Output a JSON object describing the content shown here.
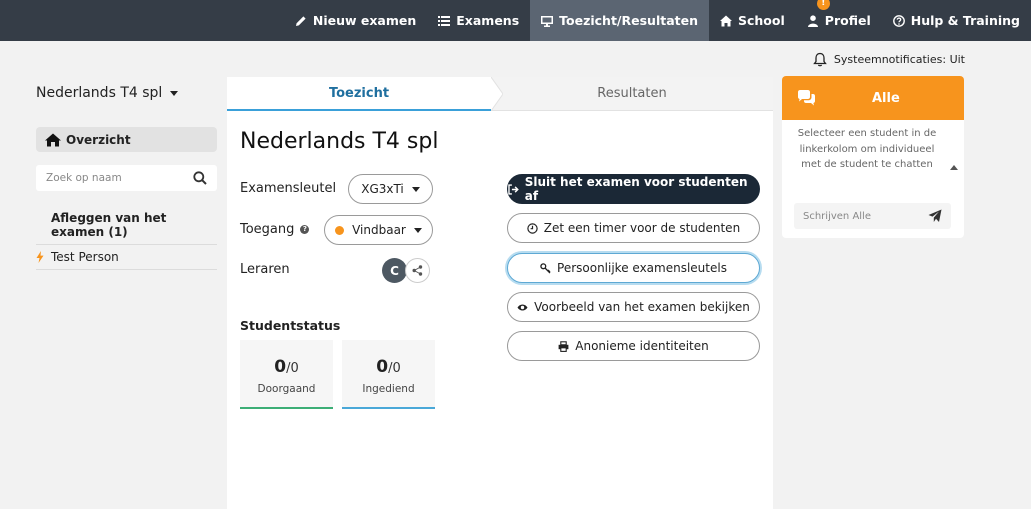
{
  "nav": {
    "items": [
      {
        "label": "Nieuw examen",
        "icon": "pencil-icon",
        "active": false
      },
      {
        "label": "Examens",
        "icon": "list-icon",
        "active": false
      },
      {
        "label": "Toezicht/Resultaten",
        "icon": "monitor-icon",
        "active": true
      },
      {
        "label": "School",
        "icon": "home-icon",
        "active": false
      },
      {
        "label": "Profiel",
        "icon": "user-icon",
        "active": false,
        "badge": "!"
      },
      {
        "label": "Hulp & Training",
        "icon": "question-circle-icon",
        "active": false
      }
    ]
  },
  "notifications": {
    "label": "Systeemnotificaties: Uit",
    "icon": "bell-icon"
  },
  "sidebar": {
    "exam_name": "Nederlands T4 spl",
    "overview_label": "Overzicht",
    "search_placeholder": "Zoek op naam",
    "group_title": "Afleggen van het examen (1)",
    "students": [
      {
        "name": "Test Person",
        "status_icon": "bolt-icon"
      }
    ]
  },
  "tabs": {
    "toezicht": "Toezicht",
    "resultaten": "Resultaten"
  },
  "main": {
    "title": "Nederlands T4 spl",
    "examkey_label": "Examensleutel",
    "examkey_value": "XG3xTi",
    "access_label": "Toegang",
    "access_value": "Vindbaar",
    "teachers_label": "Leraren",
    "teacher_initial": "C",
    "status_title": "Studentstatus",
    "stats": [
      {
        "value": "0",
        "total": "/0",
        "caption": "Doorgaand"
      },
      {
        "value": "0",
        "total": "/0",
        "caption": "Ingediend"
      }
    ]
  },
  "actions": {
    "close_exam": "Sluit het examen voor studenten af",
    "set_timer": "Zet een timer voor de studenten",
    "personal_keys": "Persoonlijke examensleutels",
    "preview": "Voorbeeld van het examen bekijken",
    "anonymous": "Anonieme identiteiten"
  },
  "chat": {
    "title": "Alle",
    "info": "Selecteer een student in de linkerkolom om individueel met de student te chatten",
    "input_placeholder": "Schrijven Alle"
  },
  "colors": {
    "nav_bg": "#353d47",
    "accent_orange": "#f7941d",
    "tab_blue": "#3aa0d9",
    "dark_button": "#1b2836"
  }
}
